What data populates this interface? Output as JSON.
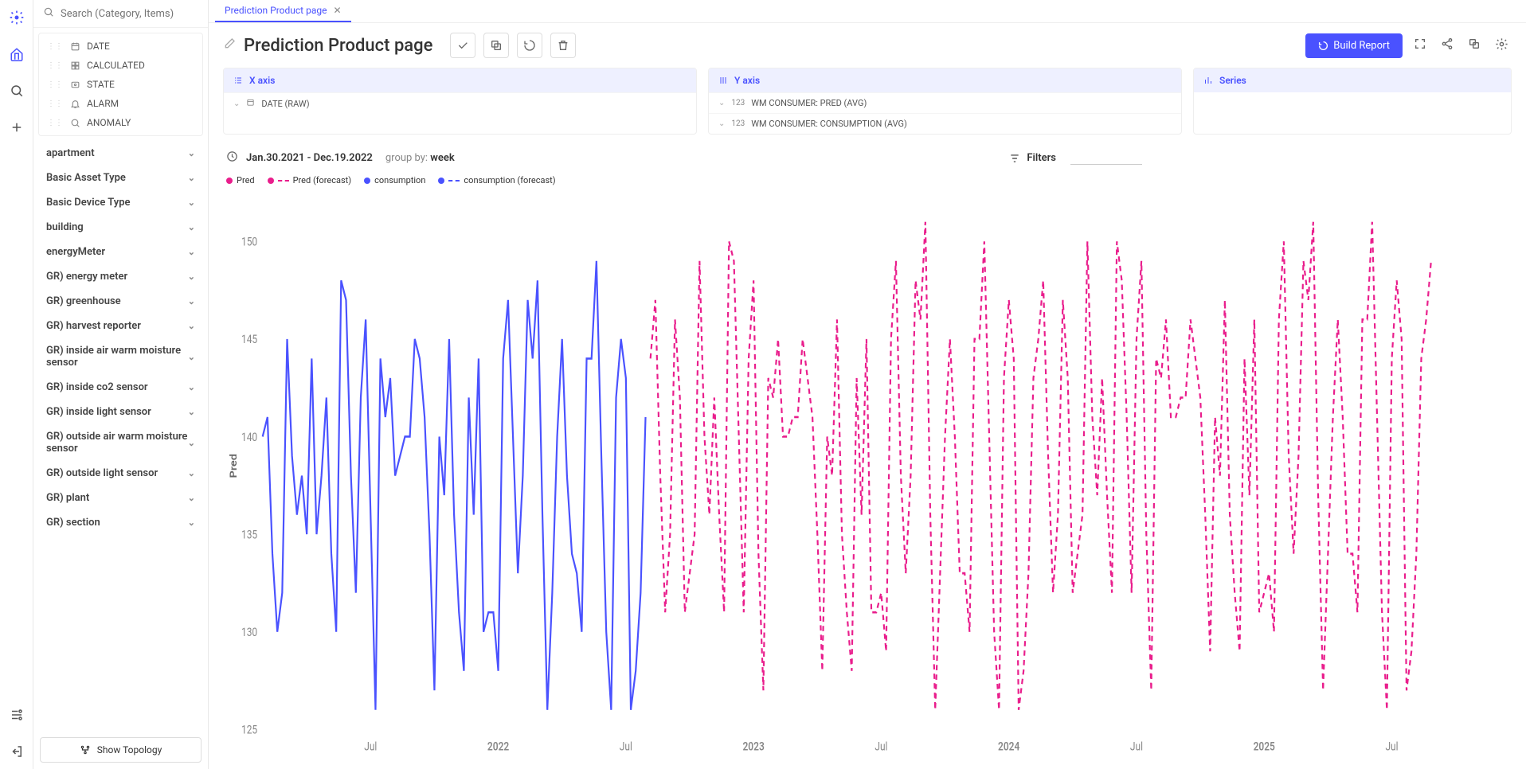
{
  "search": {
    "placeholder": "Search (Category, Items)"
  },
  "rail": {
    "items": [
      "home",
      "search",
      "add",
      "settings",
      "logout"
    ]
  },
  "tree": {
    "top_items": [
      {
        "icon": "calendar",
        "label": "DATE"
      },
      {
        "icon": "grid",
        "label": "CALCULATED"
      },
      {
        "icon": "state",
        "label": "STATE"
      },
      {
        "icon": "bell",
        "label": "ALARM"
      },
      {
        "icon": "search",
        "label": "ANOMALY"
      }
    ],
    "categories": [
      "apartment",
      "Basic Asset Type",
      "Basic Device Type",
      "building",
      "energyMeter",
      "GR) energy meter",
      "GR) greenhouse",
      "GR) harvest reporter",
      "GR) inside air warm moisture sensor",
      "GR) inside co2 sensor",
      "GR) inside light sensor",
      "GR) outside air warm moisture sensor",
      "GR) outside light sensor",
      "GR) plant",
      "GR) section"
    ]
  },
  "show_topology": "Show Topology",
  "tab": {
    "label": "Prediction Product page"
  },
  "page_title": "Prediction Product page",
  "build_report": "Build Report",
  "axis": {
    "x": {
      "label": "X axis",
      "items": [
        {
          "type": "cal",
          "label": "DATE (RAW)"
        }
      ]
    },
    "y": {
      "label": "Y axis",
      "items": [
        {
          "type": "123",
          "label": "WM CONSUMER: PRED (AVG)"
        },
        {
          "type": "123",
          "label": "WM CONSUMER: CONSUMPTION (AVG)"
        }
      ]
    },
    "series": {
      "label": "Series"
    }
  },
  "date_range": "Jan.30.2021 - Dec.19.2022",
  "group_by_prefix": "group by: ",
  "group_by_value": "week",
  "filters_label": "Filters",
  "legend_items": [
    {
      "color": "#e91e8c",
      "style": "solid",
      "shape": "dot",
      "label": "Pred"
    },
    {
      "color": "#e91e8c",
      "style": "dashed",
      "shape": "dot",
      "label": "Pred (forecast)"
    },
    {
      "color": "#4a52ff",
      "style": "solid",
      "shape": "dot",
      "label": "consumption"
    },
    {
      "color": "#4a52ff",
      "style": "dashed",
      "shape": "dot",
      "label": "consumption (forecast)"
    }
  ],
  "chart_data": {
    "type": "line",
    "ylabel": "Pred",
    "ylim": [
      125,
      152
    ],
    "yticks": [
      125,
      130,
      135,
      140,
      145,
      150
    ],
    "x_range": [
      "2021-02",
      "2025-12"
    ],
    "xticks": [
      "Jul",
      "2022",
      "Jul",
      "2023",
      "Jul",
      "2024",
      "Jul",
      "2025",
      "Jul"
    ],
    "series": [
      {
        "name": "consumption",
        "color": "#4a52ff",
        "style": "solid",
        "x_start": "2021-02",
        "x_end": "2022-09",
        "values": [
          140,
          141,
          134,
          130,
          132,
          145,
          139,
          136,
          138,
          135,
          144,
          135,
          138,
          142,
          134,
          130,
          148,
          147,
          138,
          132,
          142,
          146,
          136,
          126,
          144,
          141,
          143,
          138,
          139,
          140,
          140,
          145,
          144,
          141,
          135,
          127,
          140,
          137,
          145,
          136,
          131,
          128,
          142,
          136,
          144,
          130,
          131,
          131,
          128,
          144,
          147,
          140,
          133,
          138,
          147,
          144,
          148,
          136,
          126,
          132,
          140,
          145,
          138,
          134,
          133,
          130,
          144,
          144,
          149,
          139,
          130,
          126,
          142,
          145,
          143,
          126,
          128,
          132,
          141
        ]
      },
      {
        "name": "Pred (forecast)",
        "color": "#e91e8c",
        "style": "dashed",
        "x_start": "2022-09",
        "x_end": "2025-12",
        "values": [
          144,
          147,
          138,
          131,
          135,
          146,
          142,
          131,
          133,
          135,
          149,
          140,
          136,
          142,
          136,
          131,
          150,
          149,
          140,
          131,
          144,
          148,
          134,
          127,
          143,
          142,
          145,
          140,
          140,
          141,
          141,
          145,
          143,
          141,
          135,
          128,
          140,
          138,
          146,
          135,
          131,
          128,
          143,
          136,
          145,
          131,
          131,
          132,
          129,
          145,
          149,
          138,
          133,
          138,
          148,
          146,
          151,
          136,
          126,
          133,
          140,
          145,
          140,
          133,
          133,
          130,
          145,
          145,
          150,
          140,
          130,
          126,
          143,
          147,
          144,
          126,
          128,
          133,
          143,
          145,
          148,
          139,
          132,
          136,
          147,
          143,
          132,
          134,
          136,
          150,
          141,
          137,
          143,
          137,
          132,
          150,
          148,
          141,
          132,
          145,
          149,
          135,
          127,
          144,
          143,
          146,
          141,
          141,
          142,
          142,
          146,
          144,
          142,
          136,
          129,
          141,
          138,
          147,
          136,
          132,
          129,
          144,
          137,
          146,
          131,
          132,
          133,
          130,
          146,
          150,
          139,
          134,
          139,
          149,
          147,
          151,
          137,
          127,
          134,
          141,
          146,
          141,
          134,
          134,
          131,
          146,
          146,
          151,
          141,
          131,
          126,
          144,
          148,
          145,
          127,
          129,
          134,
          144,
          146,
          149
        ]
      }
    ]
  }
}
